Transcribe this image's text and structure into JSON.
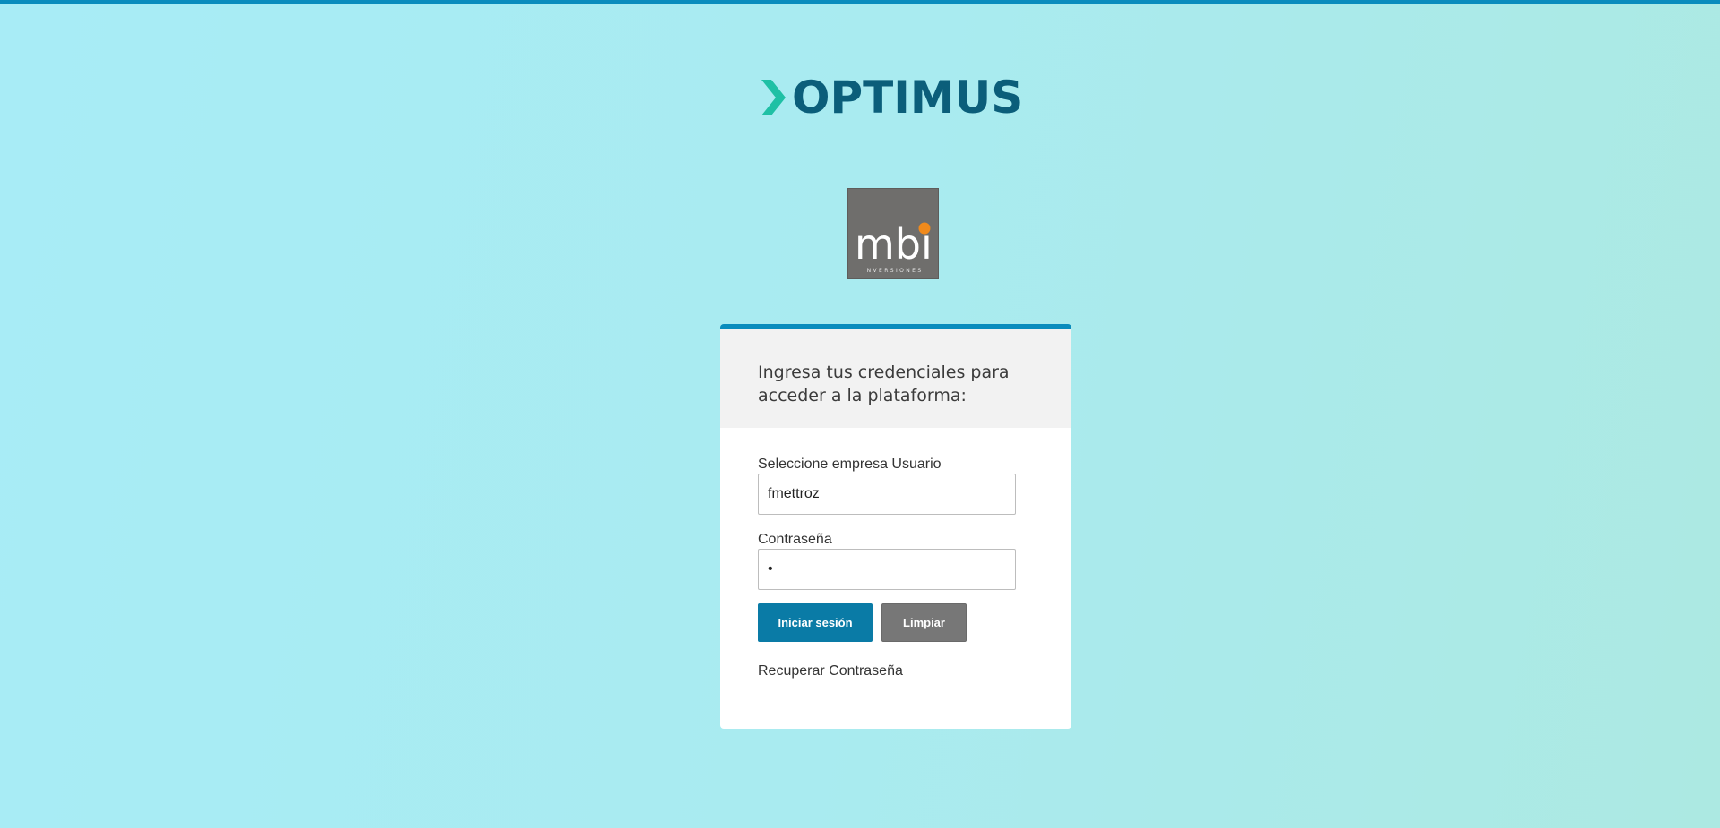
{
  "brand": {
    "name": "OPTIMUS",
    "colors": {
      "accent": "#1fc0a5",
      "text": "#0b5e7a",
      "topbar": "#0a8cbd"
    }
  },
  "client_logo": {
    "text": "mbi",
    "subtext": "INVERSIONES",
    "colors": {
      "background": "#6f6e6c",
      "dot": "#f08a1c"
    }
  },
  "login": {
    "intro": "Ingresa tus credenciales para acceder a la plataforma:",
    "user_label": "Seleccione empresa Usuario",
    "user_value": "fmettroz",
    "password_label": "Contraseña",
    "password_value": "•",
    "submit_label": "Iniciar sesión",
    "clear_label": "Limpiar",
    "recover_label": "Recuperar Contraseña"
  }
}
